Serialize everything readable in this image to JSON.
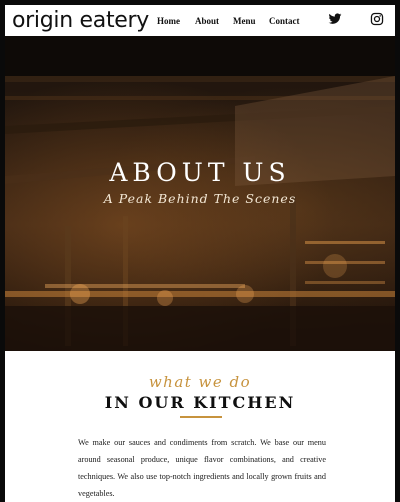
{
  "header": {
    "logo": "origin eatery",
    "nav": [
      "Home",
      "About",
      "Menu",
      "Contact"
    ],
    "social": [
      "twitter-icon",
      "instagram-icon"
    ]
  },
  "hero": {
    "title": "ABOUT US",
    "subtitle": "A Peak Behind The Scenes"
  },
  "about": {
    "kicker": "what we do",
    "title": "IN OUR KITCHEN",
    "body": "We make our sauces and condiments from scratch. We base our menu around seasonal produce, unique flavor combinations, and creative techniques. We also use top-notch ingredients and locally grown fruits and vegetables.",
    "accent_color": "#c7933e"
  }
}
